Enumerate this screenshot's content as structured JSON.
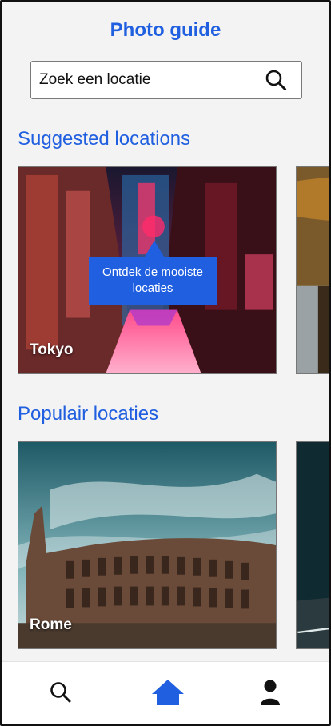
{
  "header": {
    "title": "Photo guide"
  },
  "search": {
    "placeholder": "Zoek een locatie"
  },
  "suggested": {
    "title": "Suggested locations",
    "cards": [
      {
        "label": "Tokyo",
        "tooltip": "Ontdek de mooiste locaties"
      },
      {
        "label": ""
      }
    ]
  },
  "popular": {
    "title": "Populair locaties",
    "cards": [
      {
        "label": "Rome"
      },
      {
        "label": ""
      }
    ]
  },
  "tabbar": {
    "items": [
      {
        "icon": "search-icon",
        "active": false
      },
      {
        "icon": "home-icon",
        "active": true
      },
      {
        "icon": "user-icon",
        "active": false
      }
    ]
  },
  "colors": {
    "accent": "#1f5fe0",
    "text": "#111111",
    "background": "#f3f3f3"
  }
}
